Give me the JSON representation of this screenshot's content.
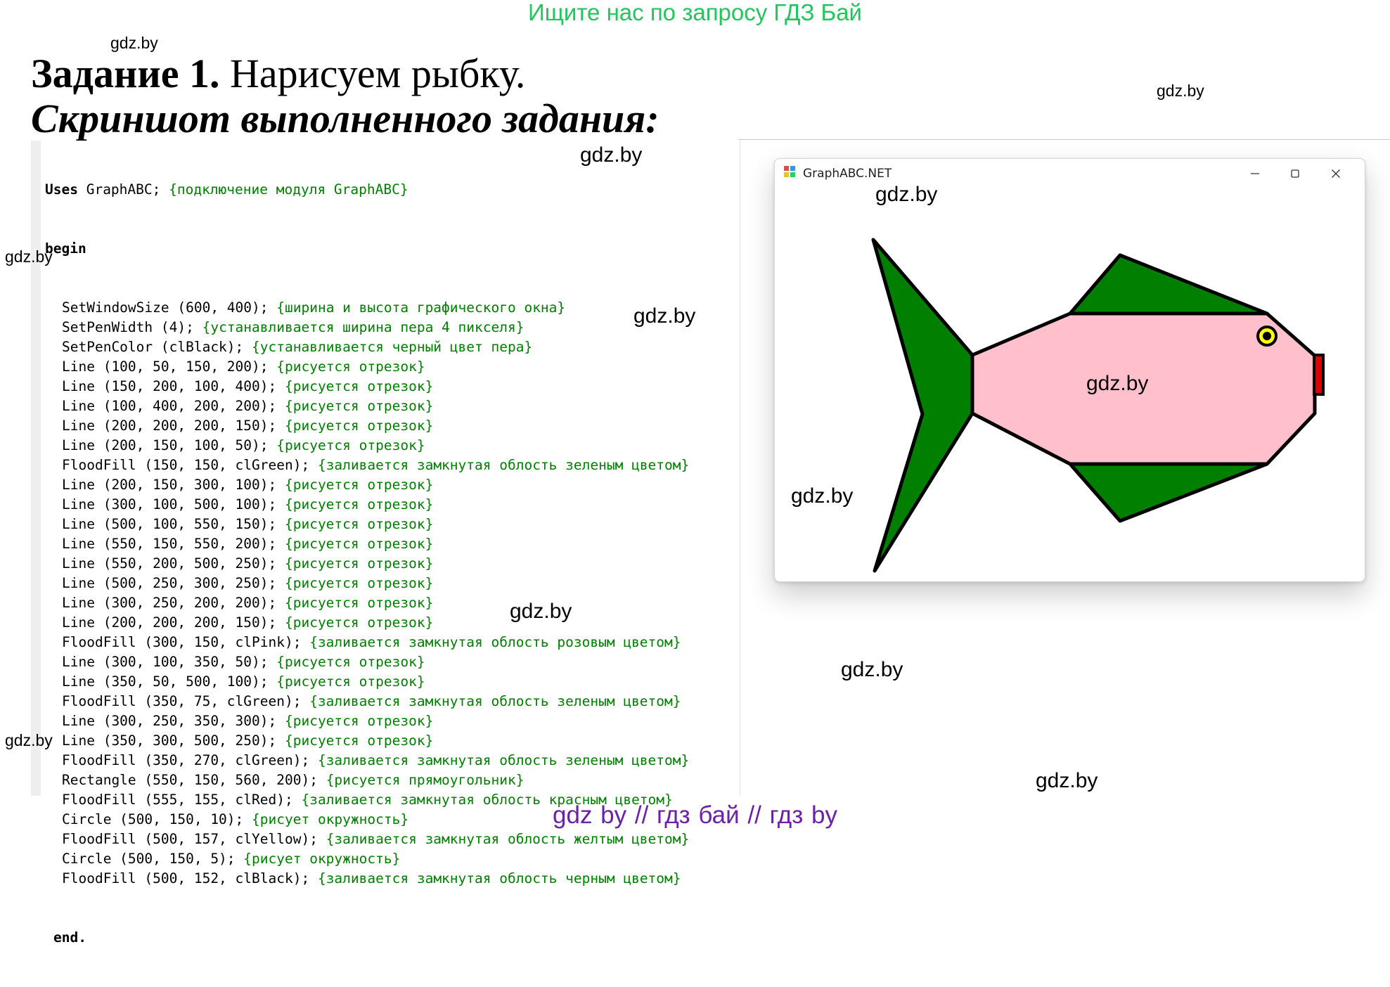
{
  "top_banner": "Ищите нас по запросу ГДЗ Бай",
  "heading": {
    "bold": "Задание 1.",
    "rest": " Нарисуем рыбку."
  },
  "subheading": "Скриншот выполненного задания:",
  "code": {
    "uses_keyword": "Uses",
    "uses_text": " GraphABC; ",
    "uses_comment": "{подключение модуля GraphABC}",
    "begin": "begin",
    "end": "end.",
    "lines": [
      {
        "code": "SetWindowSize (600, 400); ",
        "comment": "{ширина и высота графического окна}"
      },
      {
        "code": "SetPenWidth (4); ",
        "comment": "{устанавливается ширина пера 4 пикселя}"
      },
      {
        "code": "SetPenColor (clBlack); ",
        "comment": "{устанавливается черный цвет пера}"
      },
      {
        "code": "Line (100, 50, 150, 200); ",
        "comment": "{рисуется отрезок}"
      },
      {
        "code": "Line (150, 200, 100, 400); ",
        "comment": "{рисуется отрезок}"
      },
      {
        "code": "Line (100, 400, 200, 200); ",
        "comment": "{рисуется отрезок}"
      },
      {
        "code": "Line (200, 200, 200, 150); ",
        "comment": "{рисуется отрезок}"
      },
      {
        "code": "Line (200, 150, 100, 50); ",
        "comment": "{рисуется отрезок}"
      },
      {
        "code": "FloodFill (150, 150, clGreen); ",
        "comment": "{заливается замкнутая облость зеленым цветом}"
      },
      {
        "code": "Line (200, 150, 300, 100); ",
        "comment": "{рисуется отрезок}"
      },
      {
        "code": "Line (300, 100, 500, 100); ",
        "comment": "{рисуется отрезок}"
      },
      {
        "code": "Line (500, 100, 550, 150); ",
        "comment": "{рисуется отрезок}"
      },
      {
        "code": "Line (550, 150, 550, 200); ",
        "comment": "{рисуется отрезок}"
      },
      {
        "code": "Line (550, 200, 500, 250); ",
        "comment": "{рисуется отрезок}"
      },
      {
        "code": "Line (500, 250, 300, 250); ",
        "comment": "{рисуется отрезок}"
      },
      {
        "code": "Line (300, 250, 200, 200); ",
        "comment": "{рисуется отрезок}"
      },
      {
        "code": "Line (200, 200, 200, 150); ",
        "comment": "{рисуется отрезок}"
      },
      {
        "code": "FloodFill (300, 150, clPink); ",
        "comment": "{заливается замкнутая облость розовым цветом}"
      },
      {
        "code": "Line (300, 100, 350, 50); ",
        "comment": "{рисуется отрезок}"
      },
      {
        "code": "Line (350, 50, 500, 100); ",
        "comment": "{рисуется отрезок}"
      },
      {
        "code": "FloodFill (350, 75, clGreen); ",
        "comment": "{заливается замкнутая облость зеленым цветом}"
      },
      {
        "code": "Line (300, 250, 350, 300); ",
        "comment": "{рисуется отрезок}"
      },
      {
        "code": "Line (350, 300, 500, 250); ",
        "comment": "{рисуется отрезок}"
      },
      {
        "code": "FloodFill (350, 270, clGreen); ",
        "comment": "{заливается замкнутая облость зеленым цветом}"
      },
      {
        "code": "Rectangle (550, 150, 560, 200); ",
        "comment": "{рисуется прямоугольник}"
      },
      {
        "code": "FloodFill (555, 155, clRed); ",
        "comment": "{заливается замкнутая облость красным цветом}"
      },
      {
        "code": "Circle (500, 150, 10); ",
        "comment": "{рисует окружность}"
      },
      {
        "code": "FloodFill (500, 157, clYellow); ",
        "comment": "{заливается замкнутая облость желтым цветом}"
      },
      {
        "code": "Circle (500, 150, 5); ",
        "comment": "{рисует окружность}"
      },
      {
        "code": "FloodFill (500, 152, clBlack); ",
        "comment": "{заливается замкнутая облость черным цветом}"
      }
    ]
  },
  "window": {
    "title": "GraphABC.NET",
    "colors": {
      "fin": "#007f00",
      "body": "#ffc0cb",
      "mouth": "#e00000",
      "eye": "#ffff00",
      "outline": "#000000"
    }
  },
  "watermarks": [
    "gdz.by",
    "gdz.by",
    "gdz.by",
    "gdz.by",
    "gdz.by",
    "gdz.by",
    "gdz.by",
    "gdz.by",
    "gdz.by",
    "gdz.by",
    "gdz.by",
    "gdz.by"
  ],
  "footer": "gdz by  //  гдз бай  //  гдз by",
  "colors": {
    "banner": "#22c55e",
    "comment": "#008000",
    "footer": "#6b21a8"
  }
}
